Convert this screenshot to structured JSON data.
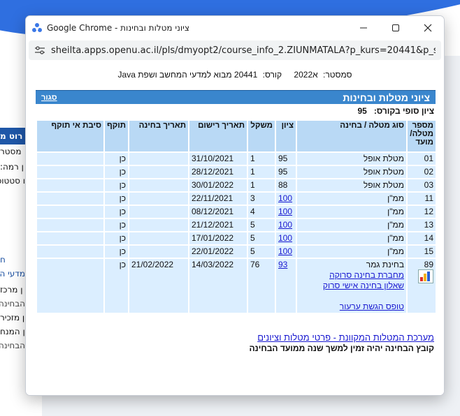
{
  "window": {
    "title": "Google Chrome - ציוני מטלות ובחינות",
    "url": "sheilta.apps.openu.ac.il/pls/dmyopt2/course_info_2.ZIUNMATALA?p_kurs=20441&p_se..."
  },
  "background": {
    "fragments": [
      "רוט מ",
      "מסטר",
      "ן רמה:",
      "ו סטטוס",
      "ח",
      "מדעי המ",
      "ן מרכז",
      "הבחינה כ",
      "ן מזכיר",
      "ן המנח",
      "הבחינה כ"
    ]
  },
  "header": {
    "semester_label": "סמסטר:",
    "semester_value": "א2022",
    "course_label": "קורס:",
    "course_value": "20441 מבוא למדעי המחשב ושפת Java"
  },
  "section": {
    "title": "ציוני מטלות ובחינות",
    "close_label": "סגור",
    "final_grade_label": "ציון סופי בקורס:",
    "final_grade_value": "95"
  },
  "table": {
    "columns": [
      "מספר מטלה/ מועד",
      "סוג מטלה / בחינה",
      "ציון",
      "משקל",
      "תאריך רישום",
      "תאריך בחינה",
      "תוקף",
      "סיבת אי תוקף"
    ],
    "rows": [
      {
        "num": "01",
        "type": "מטלת אופל",
        "grade": "95",
        "grade_link": false,
        "weight": "1",
        "reg": "31/10/2021",
        "exam": "",
        "valid": "כן"
      },
      {
        "num": "02",
        "type": "מטלת אופל",
        "grade": "95",
        "grade_link": false,
        "weight": "1",
        "reg": "28/12/2021",
        "exam": "",
        "valid": "כן"
      },
      {
        "num": "03",
        "type": "מטלת אופל",
        "grade": "88",
        "grade_link": false,
        "weight": "1",
        "reg": "30/01/2022",
        "exam": "",
        "valid": "כן"
      },
      {
        "num": "11",
        "type": "ממ\"ן",
        "grade": "100",
        "grade_link": true,
        "weight": "3",
        "reg": "22/11/2021",
        "exam": "",
        "valid": "כן"
      },
      {
        "num": "12",
        "type": "ממ\"ן",
        "grade": "100",
        "grade_link": true,
        "weight": "4",
        "reg": "08/12/2021",
        "exam": "",
        "valid": "כן"
      },
      {
        "num": "13",
        "type": "ממ\"ן",
        "grade": "100",
        "grade_link": true,
        "weight": "5",
        "reg": "21/12/2021",
        "exam": "",
        "valid": "כן"
      },
      {
        "num": "14",
        "type": "ממ\"ן",
        "grade": "100",
        "grade_link": true,
        "weight": "5",
        "reg": "17/01/2022",
        "exam": "",
        "valid": "כן"
      },
      {
        "num": "15",
        "type": "ממ\"ן",
        "grade": "100",
        "grade_link": true,
        "weight": "5",
        "reg": "22/01/2022",
        "exam": "",
        "valid": "כן"
      }
    ],
    "exam_row": {
      "num": "89",
      "type": "בחינת גמר",
      "link1": "מחברת בחינה סרוקה",
      "link2": "שאלון בחינה אישי סרוק",
      "link3": "טופס הגשת ערעור",
      "grade": "93",
      "weight": "76",
      "reg": "14/03/2022",
      "exam": "21/02/2022",
      "valid": "כן"
    }
  },
  "footer": {
    "system_link": "מערכת המטלות המקוונת - פרטי מטלות וציונים",
    "note": "קובץ הבחינה יהיה זמין למשך שנה ממועד הבחינה"
  },
  "colors": {
    "section_header": "#3a86cd",
    "column_header": "#b9d9f5",
    "cell": "#dbeeff",
    "link": "#1a1ad0"
  }
}
